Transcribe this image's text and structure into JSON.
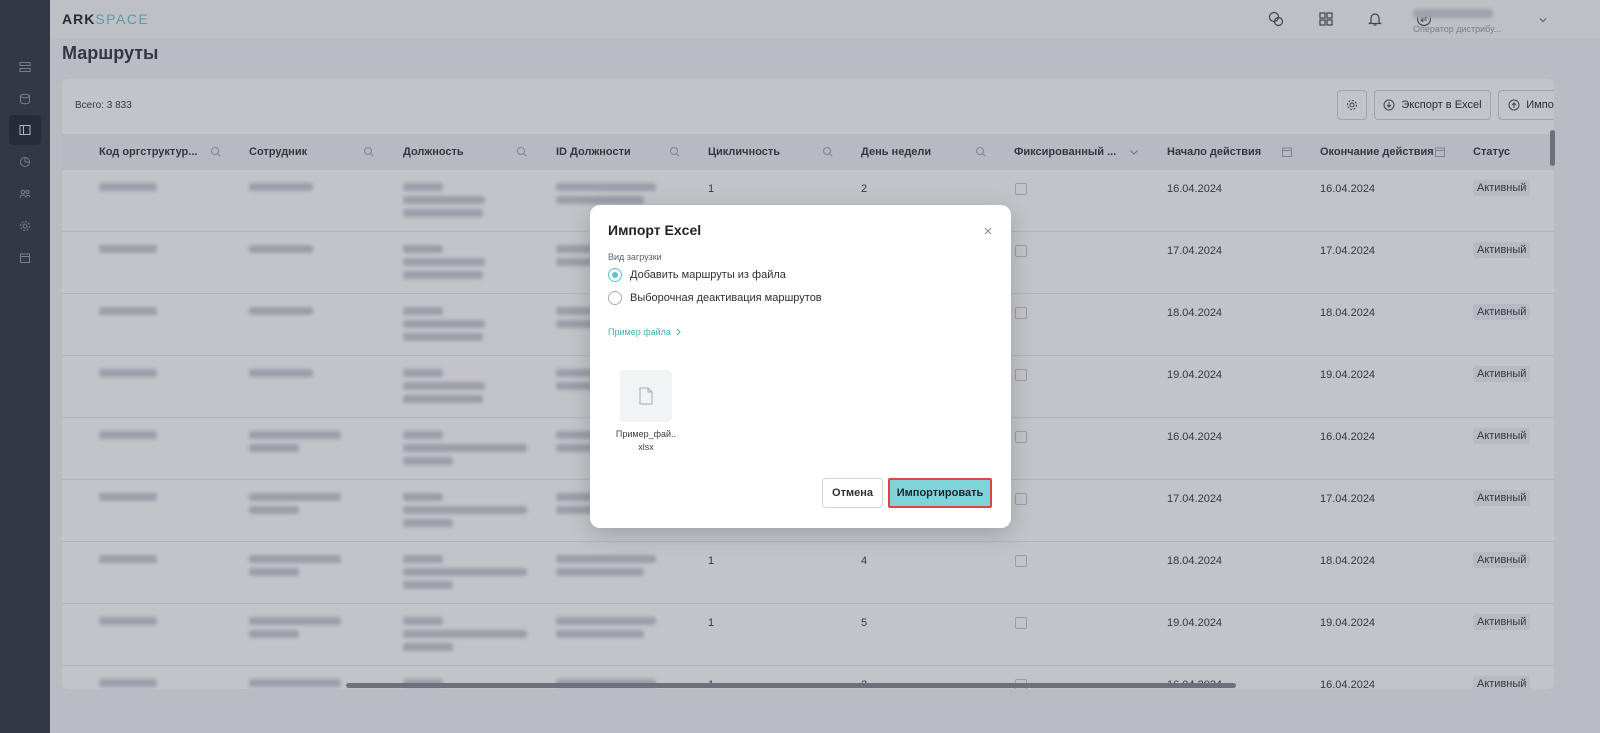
{
  "app": {
    "logo_ark": "ARK",
    "logo_space": "SPACE",
    "user_role": "Оператор дистрибу..."
  },
  "sidebar": {
    "items": [
      {
        "icon": "list-icon"
      },
      {
        "icon": "database-icon"
      },
      {
        "icon": "routes-icon",
        "active": true
      },
      {
        "icon": "chart-icon"
      },
      {
        "icon": "users-icon"
      },
      {
        "icon": "settings-icon"
      },
      {
        "icon": "calendar-icon"
      }
    ]
  },
  "page": {
    "title": "Маршруты",
    "total": "Всего: 3 833"
  },
  "toolbar": {
    "export_label": "Экспорт в Excel",
    "import_label": "Импорт"
  },
  "table": {
    "headers": {
      "org": "Код оргструктур...",
      "employee": "Сотрудник",
      "position": "Должность",
      "position_id": "ID Должности",
      "cyclicity": "Цикличность",
      "weekday": "День недели",
      "fixed": "Фиксированный ...",
      "start": "Начало действия",
      "end": "Окончание действия",
      "status": "Статус"
    },
    "rows": [
      {
        "cyclicity": "1",
        "weekday": "2",
        "start": "16.04.2024",
        "end": "16.04.2024",
        "status": "Активный"
      },
      {
        "cyclicity": "",
        "weekday": "",
        "start": "17.04.2024",
        "end": "17.04.2024",
        "status": "Активный"
      },
      {
        "cyclicity": "",
        "weekday": "",
        "start": "18.04.2024",
        "end": "18.04.2024",
        "status": "Активный"
      },
      {
        "cyclicity": "",
        "weekday": "",
        "start": "19.04.2024",
        "end": "19.04.2024",
        "status": "Активный"
      },
      {
        "cyclicity": "",
        "weekday": "",
        "start": "16.04.2024",
        "end": "16.04.2024",
        "status": "Активный"
      },
      {
        "cyclicity": "",
        "weekday": "",
        "start": "17.04.2024",
        "end": "17.04.2024",
        "status": "Активный"
      },
      {
        "cyclicity": "1",
        "weekday": "4",
        "start": "18.04.2024",
        "end": "18.04.2024",
        "status": "Активный"
      },
      {
        "cyclicity": "1",
        "weekday": "5",
        "start": "19.04.2024",
        "end": "19.04.2024",
        "status": "Активный"
      },
      {
        "cyclicity": "1",
        "weekday": "2",
        "start": "16.04.2024",
        "end": "16.04.2024",
        "status": "Активный"
      }
    ]
  },
  "modal": {
    "title": "Импорт Excel",
    "upload_type_label": "Вид загрузки",
    "option_add": "Добавить маршруты из файла",
    "option_deactivate": "Выборочная деактивация маршрутов",
    "selected_option": "option_add",
    "sample_link": "Пример файла",
    "file_name": "Пример_фай..",
    "file_ext": "xlsx",
    "cancel_label": "Отмена",
    "import_label": "Импортировать"
  },
  "colors": {
    "accent": "#5fc2ca",
    "import_button": "#7fd4d9",
    "highlight_border": "#e04444",
    "sidebar": "#3a3f4a"
  }
}
